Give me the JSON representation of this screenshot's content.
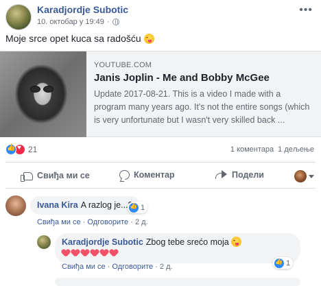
{
  "post": {
    "author": "Karadjordje Subotic",
    "date": "10. октобар у 19:49",
    "date_separator": "·",
    "menu_icon": "more-horizontal-icon",
    "text": "Moje srce opet kuca sa radošću",
    "text_emoji": "tongue-wink-emoji"
  },
  "link_card": {
    "source": "YOUTUBE.COM",
    "title": "Janis Joplin - Me and Bobby McGee",
    "description": "Update 2017-08-21. This is a video I made with a program many years ago. It's not the entire songs (which is very unfortunate but I wasn't very skilled back ..."
  },
  "reactions": {
    "types": [
      "like",
      "love"
    ],
    "count": "21",
    "comments_label": "1 коментара",
    "shares_label": "1 дељење"
  },
  "actions": {
    "like": "Свиђа ми се",
    "comment": "Коментар",
    "share": "Подели"
  },
  "comments": [
    {
      "author": "Ivana Kira",
      "text": "A razlog je...?",
      "likes": "1",
      "like_label": "Свиђа ми се",
      "reply_label": "Одговорите",
      "separator": "·",
      "time": "2 д.",
      "reply": {
        "author": "Karadjordje Subotic",
        "text": "Zbog tebe srećo moja",
        "hearts": 6,
        "likes": "1",
        "like_label": "Свиђа ми се",
        "reply_label": "Одговорите",
        "separator": "·",
        "time": "2 д."
      }
    }
  ],
  "colors": {
    "name_link": "#385898",
    "meta": "#616770",
    "card_bg": "#f2f3f5",
    "like_blue": "#2e89ff",
    "love_red": "#f0284a",
    "heart_pink": "#f25268"
  }
}
